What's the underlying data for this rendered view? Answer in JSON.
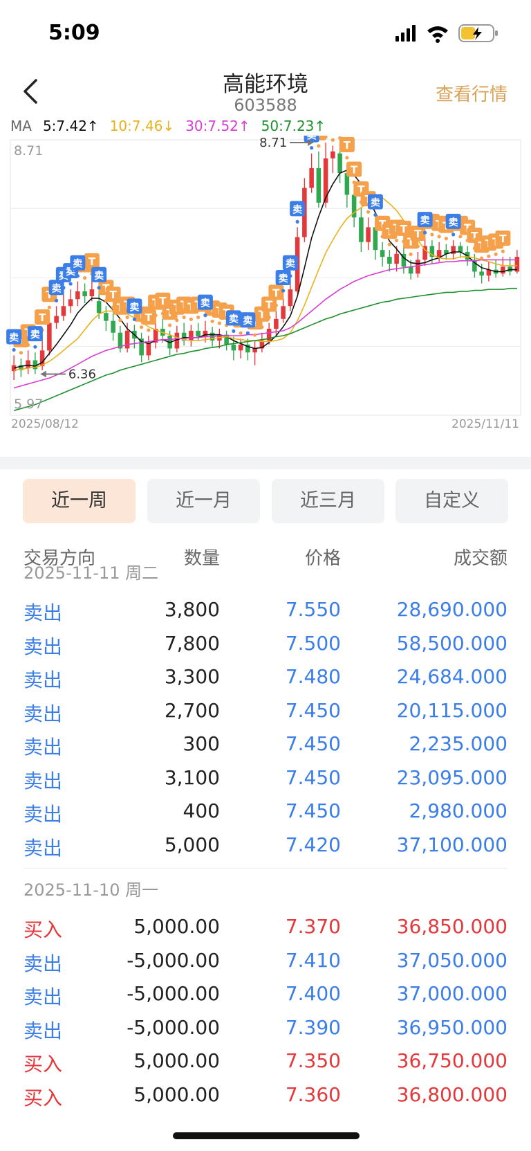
{
  "status": {
    "time": "5:09"
  },
  "header": {
    "title": "高能环境",
    "code": "603588",
    "view_quote": "查看行情"
  },
  "ma": [
    {
      "label": "MA",
      "color": "#666666"
    },
    {
      "label": "5:7.42↑",
      "color": "#111111"
    },
    {
      "label": "10:7.46↓",
      "color": "#e8b21c"
    },
    {
      "label": "30:7.52↑",
      "color": "#d63fcf"
    },
    {
      "label": "50:7.23↑",
      "color": "#1f8f2f"
    }
  ],
  "chart_data": {
    "type": "candlestick",
    "x_start": "2025/08/12",
    "x_end": "2025/11/11",
    "ylim": [
      5.97,
      8.71
    ],
    "y_top_label": "8.71",
    "y_bottom_label": "5.97",
    "high_marker": "8.71",
    "low_marker": "6.36",
    "candles": [
      {
        "o": 6.39,
        "c": 6.45,
        "h": 6.55,
        "l": 6.3
      },
      {
        "o": 6.45,
        "c": 6.4,
        "h": 6.52,
        "l": 6.33
      },
      {
        "o": 6.42,
        "c": 6.5,
        "h": 6.6,
        "l": 6.36
      },
      {
        "o": 6.5,
        "c": 6.41,
        "h": 6.58,
        "l": 6.36
      },
      {
        "o": 6.44,
        "c": 6.6,
        "h": 6.75,
        "l": 6.4
      },
      {
        "o": 6.6,
        "c": 6.88,
        "h": 6.98,
        "l": 6.55
      },
      {
        "o": 6.88,
        "c": 6.95,
        "h": 7.05,
        "l": 6.82
      },
      {
        "o": 6.95,
        "c": 7.05,
        "h": 7.18,
        "l": 6.9
      },
      {
        "o": 7.05,
        "c": 7.12,
        "h": 7.22,
        "l": 6.98
      },
      {
        "o": 7.12,
        "c": 7.2,
        "h": 7.3,
        "l": 7.05
      },
      {
        "o": 7.2,
        "c": 7.15,
        "h": 7.28,
        "l": 7.08
      },
      {
        "o": 7.15,
        "c": 7.22,
        "h": 7.32,
        "l": 7.1
      },
      {
        "o": 7.1,
        "c": 6.98,
        "h": 7.18,
        "l": 6.92
      },
      {
        "o": 6.98,
        "c": 6.9,
        "h": 7.05,
        "l": 6.8
      },
      {
        "o": 6.9,
        "c": 6.78,
        "h": 6.98,
        "l": 6.7
      },
      {
        "o": 6.78,
        "c": 6.62,
        "h": 6.85,
        "l": 6.58
      },
      {
        "o": 6.62,
        "c": 6.8,
        "h": 6.88,
        "l": 6.58
      },
      {
        "o": 6.8,
        "c": 6.72,
        "h": 6.86,
        "l": 6.62
      },
      {
        "o": 6.72,
        "c": 6.55,
        "h": 6.78,
        "l": 6.48
      },
      {
        "o": 6.55,
        "c": 6.68,
        "h": 6.75,
        "l": 6.5
      },
      {
        "o": 6.68,
        "c": 6.82,
        "h": 6.9,
        "l": 6.62
      },
      {
        "o": 6.82,
        "c": 6.75,
        "h": 6.92,
        "l": 6.68
      },
      {
        "o": 6.75,
        "c": 6.62,
        "h": 6.8,
        "l": 6.55
      },
      {
        "o": 6.62,
        "c": 6.78,
        "h": 6.85,
        "l": 6.58
      },
      {
        "o": 6.78,
        "c": 6.7,
        "h": 6.88,
        "l": 6.65
      },
      {
        "o": 6.7,
        "c": 6.8,
        "h": 6.86,
        "l": 6.64
      },
      {
        "o": 6.8,
        "c": 6.74,
        "h": 6.88,
        "l": 6.7
      },
      {
        "o": 6.74,
        "c": 6.8,
        "h": 6.9,
        "l": 6.68
      },
      {
        "o": 6.78,
        "c": 6.7,
        "h": 6.84,
        "l": 6.64
      },
      {
        "o": 6.7,
        "c": 6.76,
        "h": 6.82,
        "l": 6.62
      },
      {
        "o": 6.76,
        "c": 6.66,
        "h": 6.8,
        "l": 6.6
      },
      {
        "o": 6.66,
        "c": 6.6,
        "h": 6.74,
        "l": 6.5
      },
      {
        "o": 6.6,
        "c": 6.66,
        "h": 6.72,
        "l": 6.52
      },
      {
        "o": 6.66,
        "c": 6.58,
        "h": 6.72,
        "l": 6.5
      },
      {
        "o": 6.58,
        "c": 6.62,
        "h": 6.7,
        "l": 6.45
      },
      {
        "o": 6.62,
        "c": 6.7,
        "h": 6.78,
        "l": 6.58
      },
      {
        "o": 6.7,
        "c": 6.82,
        "h": 6.88,
        "l": 6.66
      },
      {
        "o": 6.82,
        "c": 6.92,
        "h": 7.0,
        "l": 6.76
      },
      {
        "o": 6.92,
        "c": 7.05,
        "h": 7.15,
        "l": 6.88
      },
      {
        "o": 7.05,
        "c": 7.22,
        "h": 7.3,
        "l": 7.0
      },
      {
        "o": 7.2,
        "c": 7.75,
        "h": 7.85,
        "l": 7.18
      },
      {
        "o": 7.75,
        "c": 8.25,
        "h": 8.35,
        "l": 7.7
      },
      {
        "o": 8.25,
        "c": 8.45,
        "h": 8.6,
        "l": 8.2
      },
      {
        "o": 8.45,
        "c": 8.1,
        "h": 8.62,
        "l": 8.05
      },
      {
        "o": 8.1,
        "c": 8.55,
        "h": 8.71,
        "l": 8.05
      },
      {
        "o": 8.55,
        "c": 8.62,
        "h": 8.68,
        "l": 8.4
      },
      {
        "o": 8.6,
        "c": 8.4,
        "h": 8.7,
        "l": 8.3
      },
      {
        "o": 8.4,
        "c": 8.18,
        "h": 8.5,
        "l": 8.05
      },
      {
        "o": 8.18,
        "c": 7.95,
        "h": 8.25,
        "l": 7.85
      },
      {
        "o": 7.95,
        "c": 7.7,
        "h": 8.05,
        "l": 7.6
      },
      {
        "o": 7.7,
        "c": 7.85,
        "h": 7.95,
        "l": 7.62
      },
      {
        "o": 7.85,
        "c": 7.62,
        "h": 7.92,
        "l": 7.52
      },
      {
        "o": 7.62,
        "c": 7.55,
        "h": 7.7,
        "l": 7.45
      },
      {
        "o": 7.55,
        "c": 7.48,
        "h": 7.62,
        "l": 7.4
      },
      {
        "o": 7.48,
        "c": 7.58,
        "h": 7.66,
        "l": 7.4
      },
      {
        "o": 7.58,
        "c": 7.45,
        "h": 7.65,
        "l": 7.38
      },
      {
        "o": 7.45,
        "c": 7.38,
        "h": 7.52,
        "l": 7.32
      },
      {
        "o": 7.38,
        "c": 7.52,
        "h": 7.6,
        "l": 7.34
      },
      {
        "o": 7.52,
        "c": 7.66,
        "h": 7.74,
        "l": 7.46
      },
      {
        "o": 7.66,
        "c": 7.55,
        "h": 7.72,
        "l": 7.48
      },
      {
        "o": 7.55,
        "c": 7.62,
        "h": 7.7,
        "l": 7.5
      },
      {
        "o": 7.62,
        "c": 7.58,
        "h": 7.68,
        "l": 7.52
      },
      {
        "o": 7.58,
        "c": 7.66,
        "h": 7.72,
        "l": 7.52
      },
      {
        "o": 7.66,
        "c": 7.6,
        "h": 7.7,
        "l": 7.54
      },
      {
        "o": 7.6,
        "c": 7.52,
        "h": 7.66,
        "l": 7.46
      },
      {
        "o": 7.52,
        "c": 7.4,
        "h": 7.58,
        "l": 7.34
      },
      {
        "o": 7.4,
        "c": 7.36,
        "h": 7.48,
        "l": 7.28
      },
      {
        "o": 7.36,
        "c": 7.42,
        "h": 7.5,
        "l": 7.3
      },
      {
        "o": 7.42,
        "c": 7.38,
        "h": 7.52,
        "l": 7.34
      },
      {
        "o": 7.38,
        "c": 7.45,
        "h": 7.55,
        "l": 7.35
      },
      {
        "o": 7.45,
        "c": 7.4,
        "h": 7.55,
        "l": 7.36
      },
      {
        "o": 7.4,
        "c": 7.55,
        "h": 7.62,
        "l": 7.38
      }
    ],
    "ma_lines": [
      {
        "name": "MA5",
        "color": "#111111",
        "values": [
          6.42,
          6.44,
          6.45,
          6.44,
          6.48,
          6.57,
          6.66,
          6.76,
          6.86,
          6.98,
          7.06,
          7.13,
          7.13,
          7.09,
          7.01,
          6.92,
          6.82,
          6.76,
          6.69,
          6.67,
          6.7,
          6.71,
          6.68,
          6.71,
          6.73,
          6.73,
          6.73,
          6.76,
          6.76,
          6.76,
          6.74,
          6.7,
          6.67,
          6.64,
          6.62,
          6.63,
          6.68,
          6.75,
          6.84,
          6.95,
          7.15,
          7.44,
          7.74,
          7.96,
          8.15,
          8.29,
          8.4,
          8.43,
          8.38,
          8.29,
          8.14,
          8.0,
          7.86,
          7.71,
          7.63,
          7.54,
          7.49,
          7.48,
          7.49,
          7.52,
          7.54,
          7.58,
          7.6,
          7.6,
          7.56,
          7.49,
          7.44,
          7.42,
          7.4,
          7.4,
          7.42,
          7.42
        ]
      },
      {
        "name": "MA10",
        "color": "#e8b21c",
        "values": [
          6.4,
          6.41,
          6.42,
          6.43,
          6.45,
          6.49,
          6.54,
          6.6,
          6.66,
          6.72,
          6.81,
          6.9,
          6.97,
          7.0,
          7.0,
          6.99,
          6.97,
          6.93,
          6.89,
          6.84,
          6.81,
          6.78,
          6.76,
          6.73,
          6.71,
          6.7,
          6.7,
          6.71,
          6.72,
          6.73,
          6.74,
          6.72,
          6.71,
          6.7,
          6.7,
          6.69,
          6.69,
          6.7,
          6.72,
          6.78,
          6.9,
          7.06,
          7.24,
          7.42,
          7.59,
          7.72,
          7.84,
          7.94,
          8.0,
          8.05,
          8.1,
          8.14,
          8.15,
          8.09,
          8.02,
          7.92,
          7.81,
          7.72,
          7.62,
          7.57,
          7.54,
          7.53,
          7.53,
          7.55,
          7.55,
          7.54,
          7.52,
          7.5,
          7.48,
          7.46,
          7.46,
          7.46
        ]
      },
      {
        "name": "MA30",
        "color": "#d63fcf",
        "values": [
          6.22,
          6.24,
          6.26,
          6.28,
          6.3,
          6.32,
          6.35,
          6.38,
          6.42,
          6.46,
          6.5,
          6.54,
          6.57,
          6.6,
          6.62,
          6.64,
          6.66,
          6.67,
          6.68,
          6.69,
          6.7,
          6.71,
          6.71,
          6.72,
          6.72,
          6.73,
          6.73,
          6.74,
          6.74,
          6.75,
          6.75,
          6.75,
          6.75,
          6.76,
          6.76,
          6.77,
          6.78,
          6.79,
          6.8,
          6.83,
          6.88,
          6.94,
          7.0,
          7.06,
          7.12,
          7.17,
          7.22,
          7.26,
          7.3,
          7.33,
          7.36,
          7.38,
          7.4,
          7.42,
          7.43,
          7.44,
          7.45,
          7.46,
          7.47,
          7.48,
          7.49,
          7.5,
          7.5,
          7.51,
          7.51,
          7.51,
          7.52,
          7.52,
          7.52,
          7.52,
          7.52,
          7.52
        ]
      },
      {
        "name": "MA50",
        "color": "#1f8f2f",
        "values": [
          5.99,
          6.01,
          6.03,
          6.05,
          6.08,
          6.11,
          6.14,
          6.17,
          6.2,
          6.23,
          6.26,
          6.29,
          6.32,
          6.35,
          6.37,
          6.4,
          6.42,
          6.44,
          6.46,
          6.48,
          6.5,
          6.52,
          6.54,
          6.56,
          6.57,
          6.59,
          6.6,
          6.62,
          6.63,
          6.64,
          6.66,
          6.67,
          6.68,
          6.69,
          6.7,
          6.71,
          6.72,
          6.74,
          6.75,
          6.77,
          6.8,
          6.83,
          6.86,
          6.89,
          6.92,
          6.94,
          6.97,
          6.99,
          7.01,
          7.03,
          7.05,
          7.07,
          7.09,
          7.1,
          7.12,
          7.13,
          7.14,
          7.15,
          7.16,
          7.17,
          7.18,
          7.19,
          7.19,
          7.2,
          7.2,
          7.21,
          7.21,
          7.22,
          7.22,
          7.22,
          7.23,
          7.23
        ]
      }
    ]
  },
  "tabs": [
    {
      "label": "近一周",
      "active": true
    },
    {
      "label": "近一月",
      "active": false
    },
    {
      "label": "近三月",
      "active": false
    },
    {
      "label": "自定义",
      "active": false
    }
  ],
  "columns": {
    "direction": "交易方向",
    "qty": "数量",
    "price": "价格",
    "amount": "成交额"
  },
  "groups": [
    {
      "date": "2025-11-11 周二",
      "rows": [
        {
          "dir": "卖出",
          "side": "sell",
          "qty": "3,800",
          "price": "7.550",
          "amount": "28,690.000"
        },
        {
          "dir": "卖出",
          "side": "sell",
          "qty": "7,800",
          "price": "7.500",
          "amount": "58,500.000"
        },
        {
          "dir": "卖出",
          "side": "sell",
          "qty": "3,300",
          "price": "7.480",
          "amount": "24,684.000"
        },
        {
          "dir": "卖出",
          "side": "sell",
          "qty": "2,700",
          "price": "7.450",
          "amount": "20,115.000"
        },
        {
          "dir": "卖出",
          "side": "sell",
          "qty": "300",
          "price": "7.450",
          "amount": "2,235.000"
        },
        {
          "dir": "卖出",
          "side": "sell",
          "qty": "3,100",
          "price": "7.450",
          "amount": "23,095.000"
        },
        {
          "dir": "卖出",
          "side": "sell",
          "qty": "400",
          "price": "7.450",
          "amount": "2,980.000"
        },
        {
          "dir": "卖出",
          "side": "sell",
          "qty": "5,000",
          "price": "7.420",
          "amount": "37,100.000"
        }
      ]
    },
    {
      "date": "2025-11-10 周一",
      "rows": [
        {
          "dir": "买入",
          "side": "buy",
          "qty": "5,000.00",
          "price": "7.370",
          "amount": "36,850.000"
        },
        {
          "dir": "卖出",
          "side": "sell",
          "qty": "-5,000.00",
          "price": "7.410",
          "amount": "37,050.000"
        },
        {
          "dir": "卖出",
          "side": "sell",
          "qty": "-5,000.00",
          "price": "7.400",
          "amount": "37,000.000"
        },
        {
          "dir": "卖出",
          "side": "sell",
          "qty": "-5,000.00",
          "price": "7.390",
          "amount": "36,950.000"
        },
        {
          "dir": "买入",
          "side": "buy",
          "qty": "5,000.00",
          "price": "7.350",
          "amount": "36,750.000"
        },
        {
          "dir": "买入",
          "side": "buy",
          "qty": "5,000.00",
          "price": "7.360",
          "amount": "36,800.000"
        }
      ]
    }
  ],
  "markers": {
    "sell_label": "卖",
    "t_label": "T"
  }
}
